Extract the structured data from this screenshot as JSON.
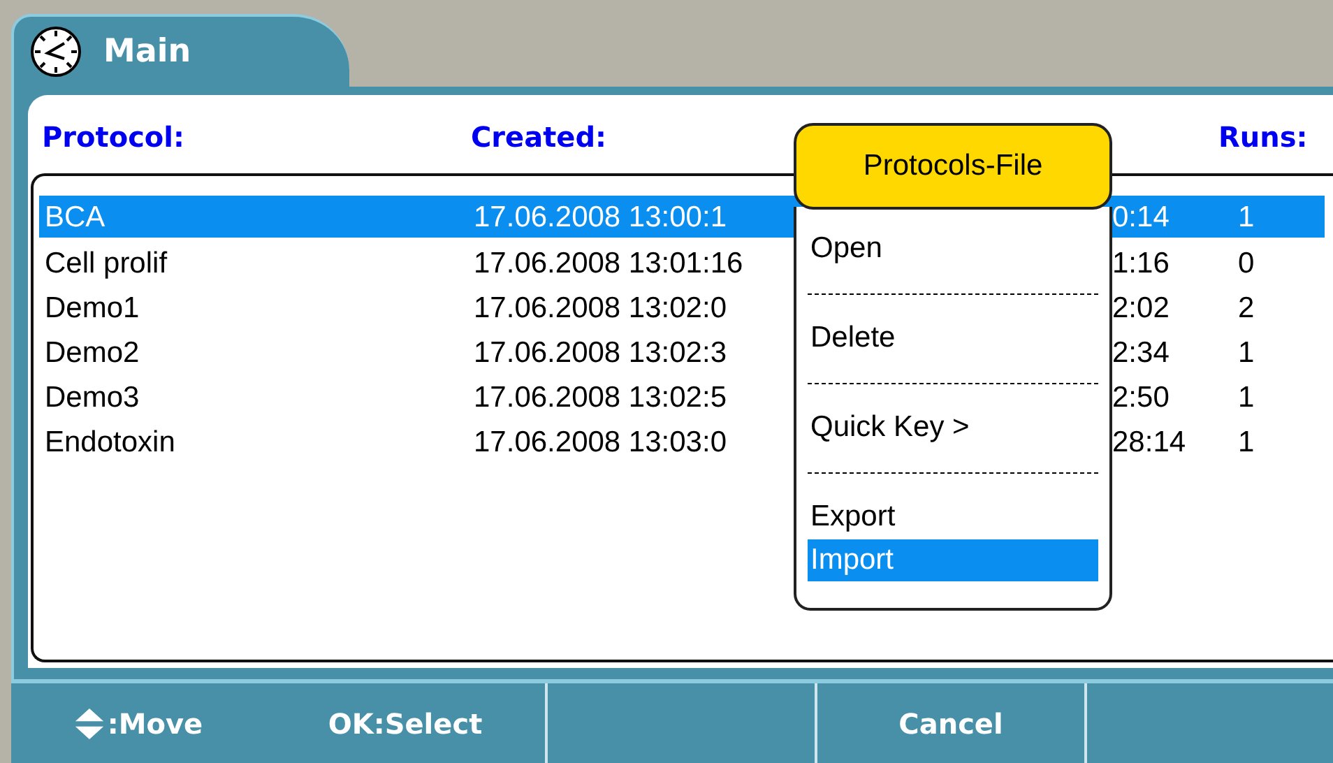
{
  "tab": {
    "title": "Main"
  },
  "columns": [
    {
      "label": "Protocol:"
    },
    {
      "label": "Created:"
    },
    {
      "label": "Runs:"
    }
  ],
  "rows": [
    {
      "protocol": "BCA",
      "created": "17.06.2008 13:00:1",
      "column_3": "0:14",
      "runs": "1",
      "selected": true
    },
    {
      "protocol": "Cell prolif",
      "created": "17.06.2008 13:01:16",
      "column_3": "1:16",
      "runs": "0",
      "selected": false
    },
    {
      "protocol": "Demo1",
      "created": "17.06.2008 13:02:0",
      "column_3": "2:02",
      "runs": "2",
      "selected": false
    },
    {
      "protocol": "Demo2",
      "created": "17.06.2008 13:02:3",
      "column_3": "2:34",
      "runs": "1",
      "selected": false
    },
    {
      "protocol": "Demo3",
      "created": "17.06.2008 13:02:5",
      "column_3": "2:50",
      "runs": "1",
      "selected": false
    },
    {
      "protocol": "Endotoxin",
      "created": "17.06.2008 13:03:0",
      "column_3": "28:14",
      "runs": "1",
      "selected": false
    }
  ],
  "popup": {
    "title": "Protocols-File",
    "items": [
      {
        "kind": "item",
        "label": "Open",
        "selected": false
      },
      {
        "kind": "separator"
      },
      {
        "kind": "item",
        "label": "Delete",
        "selected": false
      },
      {
        "kind": "separator"
      },
      {
        "kind": "item",
        "label": "Quick Key >",
        "selected": false
      },
      {
        "kind": "separator"
      },
      {
        "kind": "item",
        "label": "Export",
        "selected": false
      },
      {
        "kind": "item",
        "label": "Import",
        "selected": true
      }
    ]
  },
  "softkeys": [
    {
      "kind": "keys",
      "keys": [
        {
          "kind": "move",
          "label": ":Move"
        },
        {
          "kind": "plain",
          "label": "OK:Select"
        }
      ]
    },
    {
      "kind": "blank"
    },
    {
      "kind": "keys",
      "keys": [
        {
          "kind": "plain",
          "label": "Cancel"
        }
      ]
    },
    {
      "kind": "blank"
    }
  ]
}
